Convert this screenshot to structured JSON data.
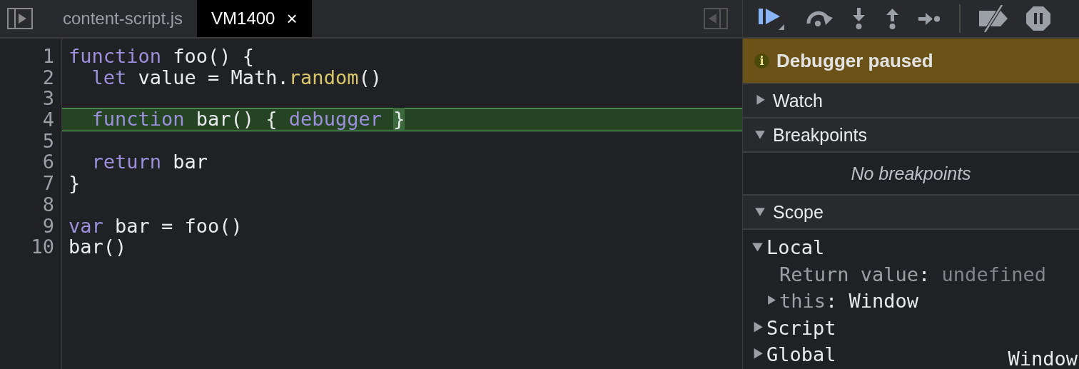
{
  "tabs": [
    {
      "label": "content-script.js",
      "selected": false
    },
    {
      "label": "VM1400",
      "selected": true,
      "close": "×"
    }
  ],
  "code": [
    {
      "number": "1",
      "current": false,
      "indented": false,
      "tokens": [
        {
          "kind": "keyword",
          "text": "function"
        },
        {
          "kind": "plain",
          "text": " foo() {"
        }
      ]
    },
    {
      "number": "2",
      "current": false,
      "indented": true,
      "tokens": [
        {
          "kind": "keyword",
          "text": "let"
        },
        {
          "kind": "plain",
          "text": " value = Math."
        },
        {
          "kind": "method",
          "text": "random"
        },
        {
          "kind": "plain",
          "text": "()"
        }
      ]
    },
    {
      "number": "3",
      "current": false
    },
    {
      "number": "4",
      "current": true,
      "indented": true,
      "tokens": [
        {
          "kind": "keyword",
          "text": "function"
        },
        {
          "kind": "plain",
          "text": " bar() { "
        },
        {
          "kind": "keyword",
          "text": "debugger "
        },
        {
          "kind": "brace",
          "text": "}"
        }
      ]
    },
    {
      "number": "5",
      "current": false
    },
    {
      "number": "6",
      "current": false,
      "indented": true,
      "tokens": [
        {
          "kind": "keyword",
          "text": "return"
        },
        {
          "kind": "plain",
          "text": " bar"
        }
      ]
    },
    {
      "number": "7",
      "current": false,
      "indented": false,
      "tokens": [
        {
          "kind": "plain",
          "text": "}"
        }
      ]
    },
    {
      "number": "8",
      "current": false
    },
    {
      "number": "9",
      "current": false,
      "indented": false,
      "tokens": [
        {
          "kind": "keyword",
          "text": "var"
        },
        {
          "kind": "plain",
          "text": " bar = foo()"
        }
      ]
    },
    {
      "number": "10",
      "current": false,
      "indented": false,
      "tokens": [
        {
          "kind": "plain",
          "text": "bar()"
        }
      ]
    }
  ],
  "banner": {
    "text": "Debugger paused",
    "icon_text": "i"
  },
  "sections": [
    {
      "title": "Watch",
      "expanded": false
    },
    {
      "title": "Breakpoints",
      "expanded": true,
      "empty_message": "No breakpoints"
    },
    {
      "title": "Scope",
      "expanded": true,
      "tree": [
        {
          "name": "Local",
          "kind": "node",
          "expanded": true,
          "children": [
            {
              "name": "Return value",
              "separator": ":",
              "value": "undefined",
              "kind": "leaf"
            },
            {
              "name": "this",
              "separator": ":",
              "value": "Window",
              "kind": "node",
              "expanded": false
            }
          ]
        },
        {
          "name": "Script",
          "kind": "node",
          "expanded": false
        },
        {
          "name": "Global",
          "kind": "node",
          "expanded": false,
          "value": "Window"
        }
      ]
    }
  ]
}
